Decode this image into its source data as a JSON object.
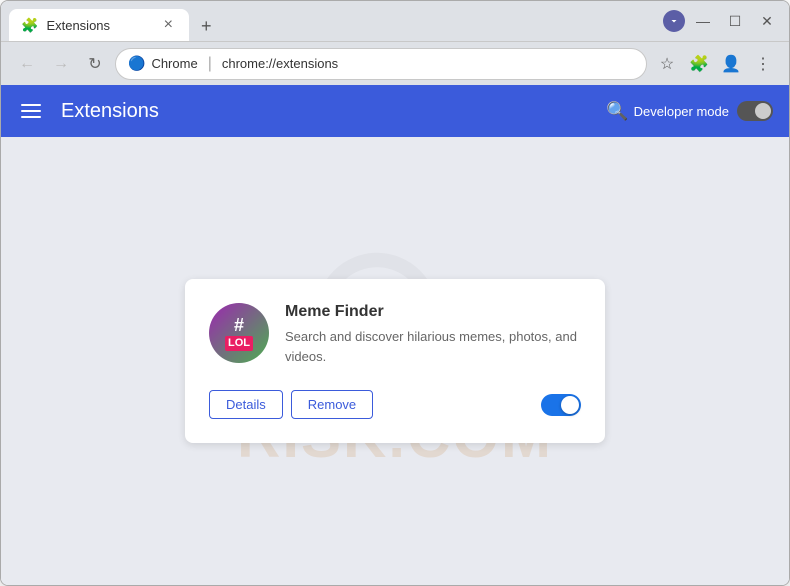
{
  "window": {
    "title": "Extensions",
    "tab_icon": "🧩",
    "close_tab_label": "×",
    "new_tab_label": "+",
    "win_minimize": "—",
    "win_restore": "☐",
    "win_close": "✕"
  },
  "nav": {
    "back_label": "←",
    "forward_label": "→",
    "reload_label": "↻",
    "site_name": "Chrome",
    "separator": "|",
    "url": "chrome://extensions",
    "bookmark_icon": "☆",
    "extensions_icon": "🧩",
    "profile_icon": "👤",
    "more_icon": "⋮"
  },
  "header": {
    "menu_label": "☰",
    "title": "Extensions",
    "search_label": "🔍",
    "dev_mode_label": "Developer mode"
  },
  "watermark": {
    "text": "RISK.COM"
  },
  "extension": {
    "name": "Meme Finder",
    "description": "Search and discover hilarious memes, photos, and videos.",
    "icon_hash": "#",
    "icon_lol": "LOL",
    "details_label": "Details",
    "remove_label": "Remove",
    "enabled": true
  },
  "colors": {
    "brand_blue": "#3b5bdb",
    "toggle_on": "#1a73e8"
  }
}
